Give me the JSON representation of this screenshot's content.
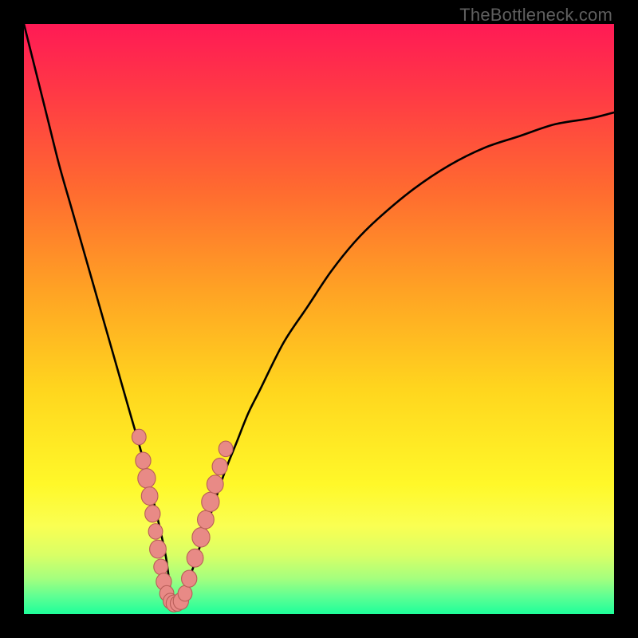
{
  "watermark": "TheBottleneck.com",
  "colors": {
    "frame": "#000000",
    "curve_stroke": "#000000",
    "marker_fill": "#e88a86",
    "marker_stroke": "#b85d58",
    "gradient_stops": [
      {
        "offset": 0.0,
        "color": "#ff1a55"
      },
      {
        "offset": 0.12,
        "color": "#ff3a45"
      },
      {
        "offset": 0.28,
        "color": "#ff6a30"
      },
      {
        "offset": 0.45,
        "color": "#ffa224"
      },
      {
        "offset": 0.62,
        "color": "#ffd61e"
      },
      {
        "offset": 0.78,
        "color": "#fff829"
      },
      {
        "offset": 0.85,
        "color": "#faff52"
      },
      {
        "offset": 0.9,
        "color": "#d9ff66"
      },
      {
        "offset": 0.94,
        "color": "#a4ff7e"
      },
      {
        "offset": 0.97,
        "color": "#5fff93"
      },
      {
        "offset": 1.0,
        "color": "#1eff9a"
      }
    ]
  },
  "chart_data": {
    "type": "line",
    "title": "",
    "xlabel": "",
    "ylabel": "",
    "xlim": [
      0,
      100
    ],
    "ylim": [
      0,
      100
    ],
    "grid": false,
    "legend": false,
    "series": [
      {
        "name": "bottleneck-curve",
        "x": [
          0,
          2,
          4,
          6,
          8,
          10,
          12,
          14,
          16,
          18,
          20,
          22,
          24,
          25,
          26,
          28,
          30,
          32,
          34,
          36,
          38,
          40,
          44,
          48,
          52,
          56,
          60,
          66,
          72,
          78,
          84,
          90,
          96,
          100
        ],
        "y": [
          100,
          92,
          84,
          76,
          69,
          62,
          55,
          48,
          41,
          34,
          27,
          19,
          10,
          3,
          2,
          6,
          12,
          18,
          24,
          29,
          34,
          38,
          46,
          52,
          58,
          63,
          67,
          72,
          76,
          79,
          81,
          83,
          84,
          85
        ]
      }
    ],
    "markers": [
      {
        "x": 19.5,
        "y": 30,
        "r": 1.2
      },
      {
        "x": 20.2,
        "y": 26,
        "r": 1.3
      },
      {
        "x": 20.8,
        "y": 23,
        "r": 1.5
      },
      {
        "x": 21.3,
        "y": 20,
        "r": 1.4
      },
      {
        "x": 21.8,
        "y": 17,
        "r": 1.3
      },
      {
        "x": 22.3,
        "y": 14,
        "r": 1.2
      },
      {
        "x": 22.7,
        "y": 11,
        "r": 1.4
      },
      {
        "x": 23.2,
        "y": 8,
        "r": 1.2
      },
      {
        "x": 23.7,
        "y": 5.5,
        "r": 1.3
      },
      {
        "x": 24.2,
        "y": 3.5,
        "r": 1.2
      },
      {
        "x": 24.8,
        "y": 2.2,
        "r": 1.2
      },
      {
        "x": 25.4,
        "y": 1.8,
        "r": 1.3
      },
      {
        "x": 26.0,
        "y": 1.8,
        "r": 1.2
      },
      {
        "x": 26.6,
        "y": 2.2,
        "r": 1.3
      },
      {
        "x": 27.3,
        "y": 3.5,
        "r": 1.2
      },
      {
        "x": 28.0,
        "y": 6,
        "r": 1.3
      },
      {
        "x": 29.0,
        "y": 9.5,
        "r": 1.4
      },
      {
        "x": 30.0,
        "y": 13,
        "r": 1.5
      },
      {
        "x": 30.8,
        "y": 16,
        "r": 1.4
      },
      {
        "x": 31.6,
        "y": 19,
        "r": 1.5
      },
      {
        "x": 32.4,
        "y": 22,
        "r": 1.4
      },
      {
        "x": 33.2,
        "y": 25,
        "r": 1.3
      },
      {
        "x": 34.2,
        "y": 28,
        "r": 1.2
      }
    ]
  }
}
